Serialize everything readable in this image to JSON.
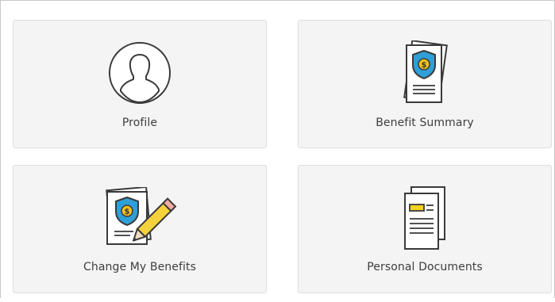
{
  "tiles": {
    "profile": {
      "label": "Profile",
      "icon": "profile-avatar-icon"
    },
    "benefit_summary": {
      "label": "Benefit Summary",
      "icon": "benefit-summary-document-icon"
    },
    "change_benefits": {
      "label": "Change My Benefits",
      "icon": "edit-benefits-pencil-icon"
    },
    "personal_documents": {
      "label": "Personal Documents",
      "icon": "personal-documents-icon"
    }
  },
  "colors": {
    "tile_background": "#f4f4f4",
    "tile_border": "#dedede",
    "icon_outline": "#3a3a3a",
    "shield_blue": "#2f9fd8",
    "coin_gold": "#f3c21b",
    "document_highlight": "#f3d31b",
    "pencil_yellow": "#f5d23c"
  }
}
